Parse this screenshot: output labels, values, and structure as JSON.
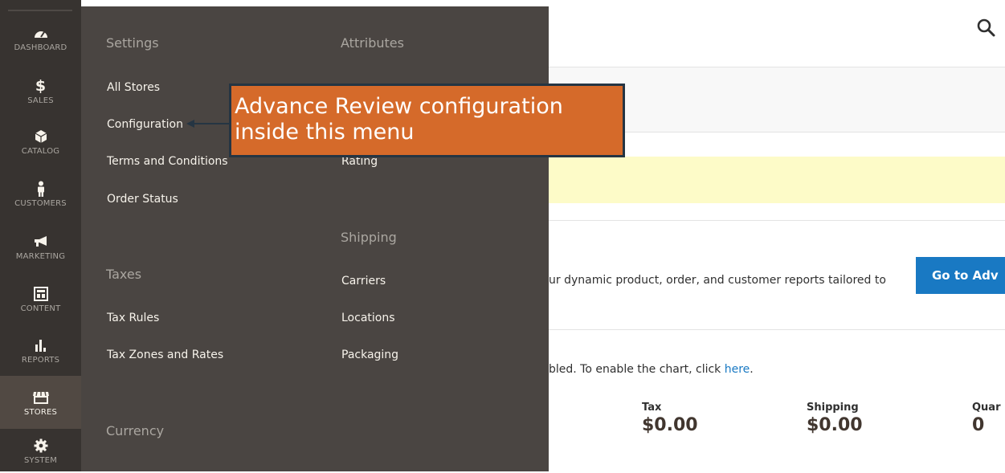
{
  "header": {
    "search_icon": "search-icon"
  },
  "main": {
    "reports_text": "ur dynamic product, order, and customer reports tailored to",
    "advanced_button": "Go to Adv",
    "chart_text": "bled. To enable the chart, click ",
    "chart_link": "here",
    "chart_end": ".",
    "stats": [
      {
        "label": "Tax",
        "value": "$0.00"
      },
      {
        "label": "Shipping",
        "value": "$0.00"
      },
      {
        "label": "Quar",
        "value": "0"
      }
    ]
  },
  "nav": {
    "items": [
      {
        "label": "DASHBOARD",
        "icon": "dashboard-icon"
      },
      {
        "label": "SALES",
        "icon": "dollar-icon"
      },
      {
        "label": "CATALOG",
        "icon": "box-icon"
      },
      {
        "label": "CUSTOMERS",
        "icon": "person-icon"
      },
      {
        "label": "MARKETING",
        "icon": "megaphone-icon"
      },
      {
        "label": "CONTENT",
        "icon": "layout-icon"
      },
      {
        "label": "REPORTS",
        "icon": "bar-chart-icon"
      },
      {
        "label": "STORES",
        "icon": "store-icon",
        "active": true
      },
      {
        "label": "SYSTEM",
        "icon": "gear-icon"
      }
    ]
  },
  "flyout": {
    "col1": {
      "settings_title": "Settings",
      "settings": [
        "All Stores",
        "Configuration",
        "Terms and Conditions",
        "Order Status"
      ],
      "taxes_title": "Taxes",
      "taxes": [
        "Tax Rules",
        "Tax Zones and Rates"
      ],
      "currency_title": "Currency"
    },
    "col2": {
      "attributes_title": "Attributes",
      "attributes": [
        "Rating"
      ],
      "shipping_title": "Shipping",
      "shipping": [
        "Carriers",
        "Locations",
        "Packaging"
      ]
    }
  },
  "callout": {
    "line1": "Advance Review configuration",
    "line2": "inside this menu",
    "color": "#d56a2a",
    "border_color": "#253543"
  }
}
